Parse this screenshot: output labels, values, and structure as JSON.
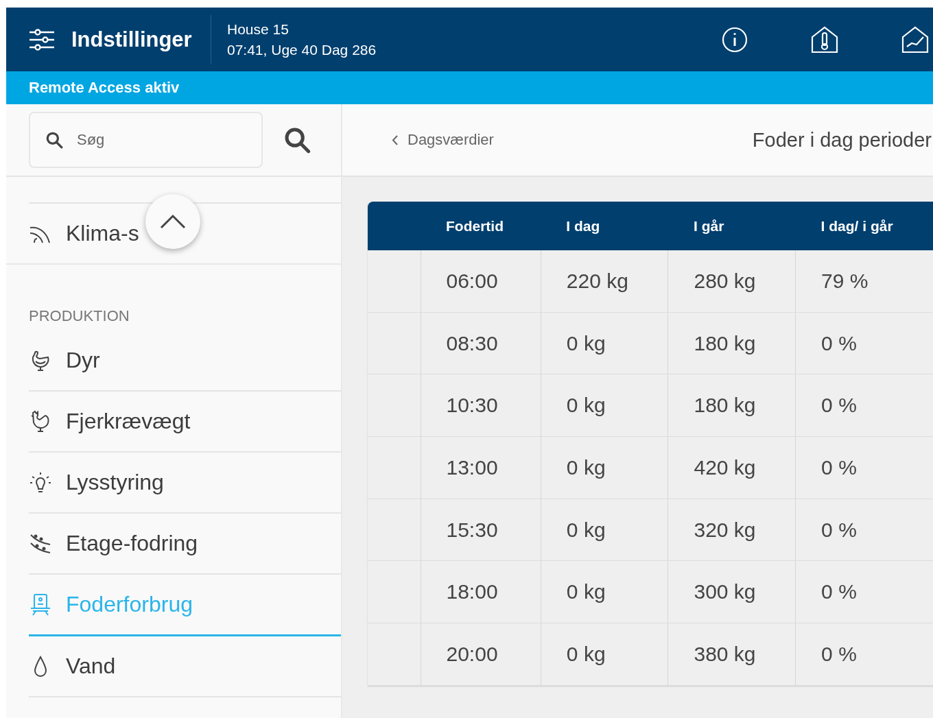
{
  "header": {
    "title": "Indstillinger",
    "house": "House 15",
    "datetime": "07:41, Uge 40 Dag 286"
  },
  "banner": "Remote Access aktiv",
  "search": {
    "placeholder": "Søg"
  },
  "sidebar": {
    "top_items": [
      {
        "label": "Klima-s",
        "selected": false
      }
    ],
    "section": "PRODUKTION",
    "items": [
      {
        "label": "Dyr",
        "selected": false
      },
      {
        "label": "Fjerkrævægt",
        "selected": false
      },
      {
        "label": "Lysstyring",
        "selected": false
      },
      {
        "label": "Etage-fodring",
        "selected": false
      },
      {
        "label": "Foderforbrug",
        "selected": true
      },
      {
        "label": "Vand",
        "selected": false
      }
    ]
  },
  "breadcrumb": "Dagsværdier",
  "page_title": "Foder i dag perioder",
  "table": {
    "columns": [
      "Fodertid",
      "I dag",
      "I går",
      "I dag/ i går"
    ],
    "rows": [
      [
        "06:00",
        "220 kg",
        "280 kg",
        "79 %"
      ],
      [
        "08:30",
        "0 kg",
        "180 kg",
        "0 %"
      ],
      [
        "10:30",
        "0 kg",
        "180 kg",
        "0 %"
      ],
      [
        "13:00",
        "0 kg",
        "420 kg",
        "0 %"
      ],
      [
        "15:30",
        "0 kg",
        "320 kg",
        "0 %"
      ],
      [
        "18:00",
        "0 kg",
        "300 kg",
        "0 %"
      ],
      [
        "20:00",
        "0 kg",
        "380 kg",
        "0 %"
      ]
    ]
  }
}
